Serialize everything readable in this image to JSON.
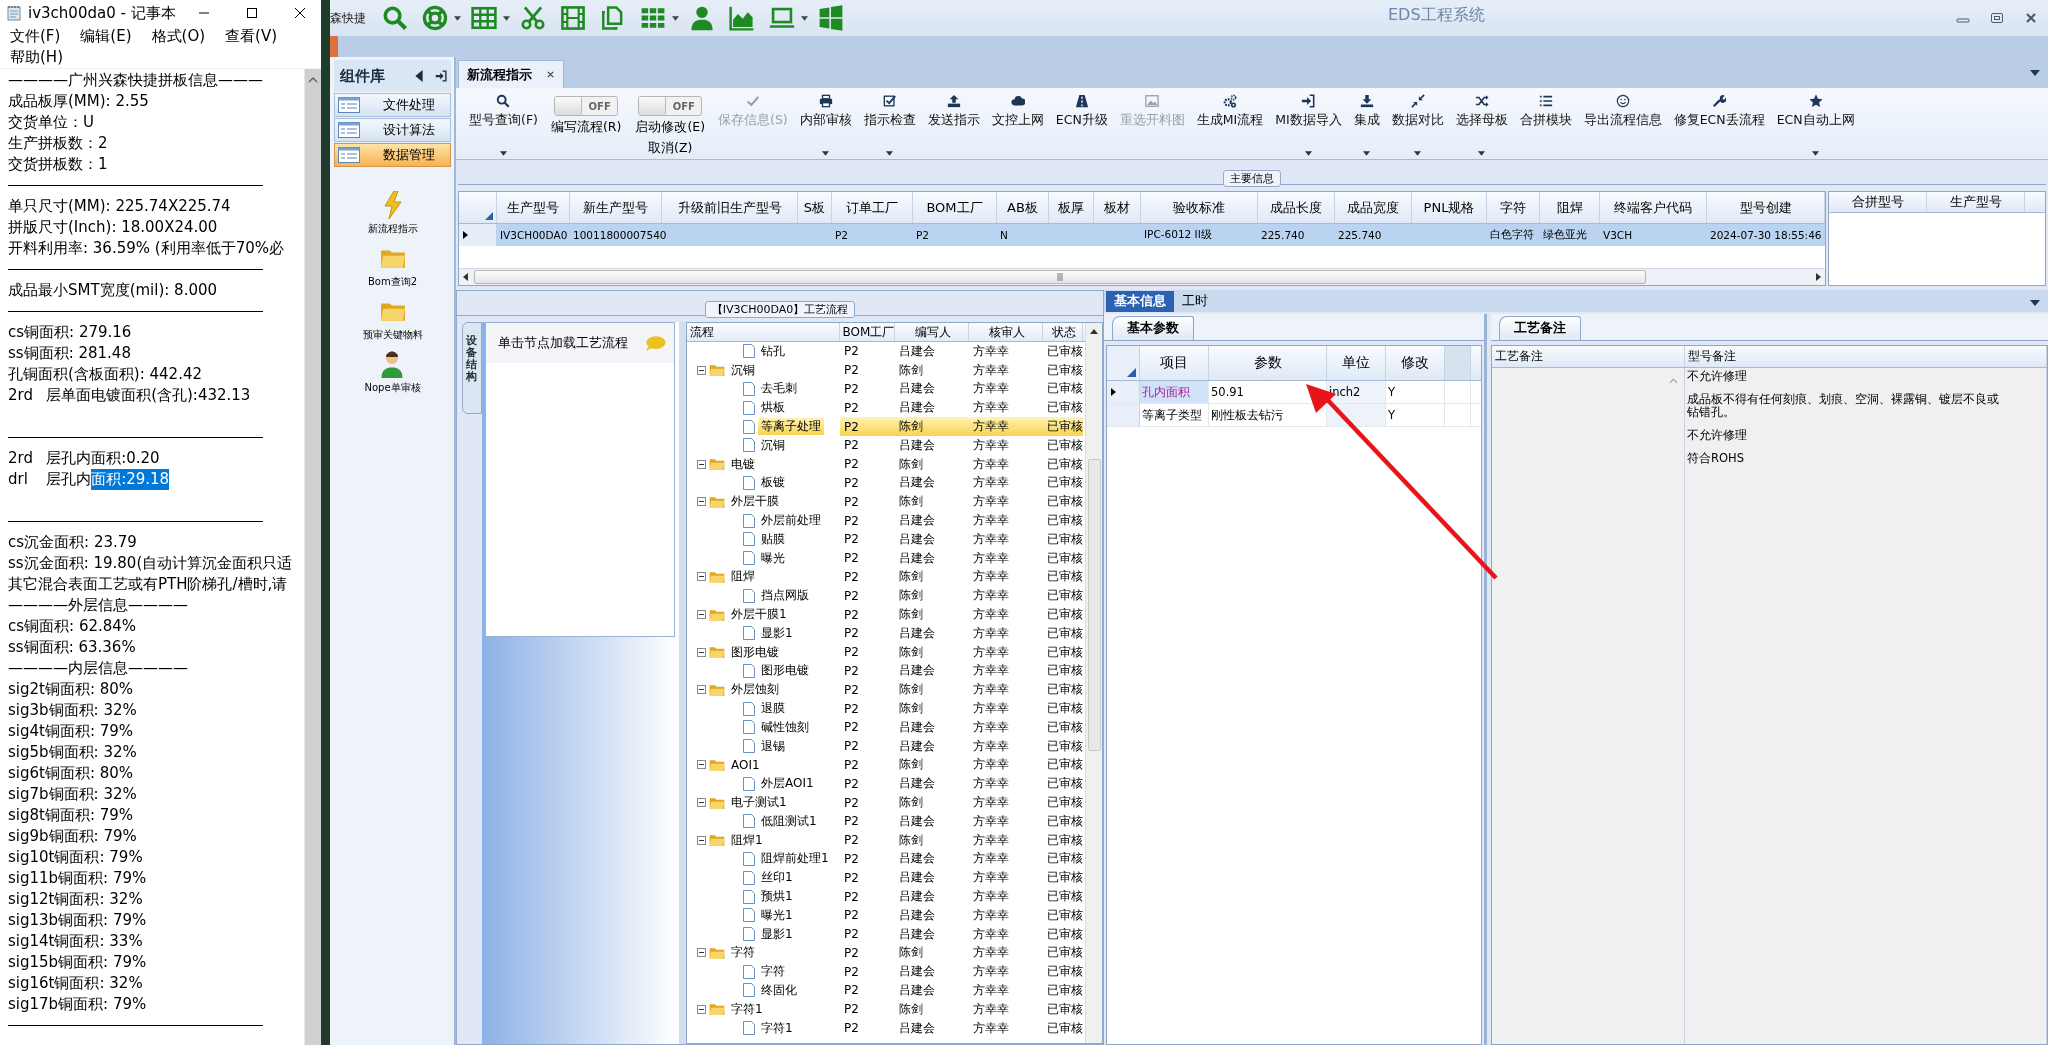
{
  "notepad": {
    "title": "iv3ch00da0 - 记事本",
    "menu": [
      "文件(F)",
      "编辑(E)",
      "格式(O)",
      "查看(V)",
      "帮助(H)"
    ],
    "lines": [
      {
        "kind": "text",
        "text": "————广州兴森快捷拼板信息———"
      },
      {
        "kind": "text",
        "text": "成品板厚(MM): 2.55"
      },
      {
        "kind": "text",
        "text": "交货单位：U"
      },
      {
        "kind": "text",
        "text": "生产拼板数：2"
      },
      {
        "kind": "text",
        "text": "交货拼板数：1"
      },
      {
        "kind": "rule"
      },
      {
        "kind": "text",
        "text": "单只尺寸(MM): 225.74X225.74"
      },
      {
        "kind": "text",
        "text": "拼版尺寸(Inch): 18.00X24.00"
      },
      {
        "kind": "text",
        "text": "开料利用率: 36.59% (利用率低于70%必"
      },
      {
        "kind": "rule"
      },
      {
        "kind": "text",
        "text": "成品最小SMT宽度(mil): 8.000"
      },
      {
        "kind": "rule"
      },
      {
        "kind": "text",
        "text": "cs铜面积: 279.16"
      },
      {
        "kind": "text",
        "text": "ss铜面积: 281.48"
      },
      {
        "kind": "text",
        "text": "孔铜面积(含板面积): 442.42"
      },
      {
        "kind": "text",
        "text": "2rd\t层单面电镀面积(含孔):432.13"
      },
      {
        "kind": "blank"
      },
      {
        "kind": "rule"
      },
      {
        "kind": "text",
        "text": "2rd\t层孔内面积:0.20"
      },
      {
        "kind": "selection",
        "text": "drl\t层孔内",
        "selected": "面积:29.18"
      },
      {
        "kind": "blank"
      },
      {
        "kind": "rule"
      },
      {
        "kind": "text",
        "text": "cs沉金面积: 23.79"
      },
      {
        "kind": "text",
        "text": "ss沉金面积: 19.80(自动计算沉金面积只适"
      },
      {
        "kind": "text",
        "text": "其它混合表面工艺或有PTH阶梯孔/槽时,请"
      },
      {
        "kind": "text",
        "text": "————外层信息————"
      },
      {
        "kind": "text",
        "text": "cs铜面积: 62.84%"
      },
      {
        "kind": "text",
        "text": "ss铜面积: 63.36%"
      },
      {
        "kind": "text",
        "text": "————内层信息————"
      },
      {
        "kind": "text",
        "text": "sig2t铜面积: 80%"
      },
      {
        "kind": "text",
        "text": "sig3b铜面积: 32%"
      },
      {
        "kind": "text",
        "text": "sig4t铜面积: 79%"
      },
      {
        "kind": "text",
        "text": "sig5b铜面积: 32%"
      },
      {
        "kind": "text",
        "text": "sig6t铜面积: 80%"
      },
      {
        "kind": "text",
        "text": "sig7b铜面积: 32%"
      },
      {
        "kind": "text",
        "text": "sig8t铜面积: 79%"
      },
      {
        "kind": "text",
        "text": "sig9b铜面积: 79%"
      },
      {
        "kind": "text",
        "text": "sig10t铜面积: 79%"
      },
      {
        "kind": "text",
        "text": "sig11b铜面积: 79%"
      },
      {
        "kind": "text",
        "text": "sig12t铜面积: 32%"
      },
      {
        "kind": "text",
        "text": "sig13b铜面积: 79%"
      },
      {
        "kind": "text",
        "text": "sig14t铜面积: 33%"
      },
      {
        "kind": "text",
        "text": "sig15b铜面积: 79%"
      },
      {
        "kind": "text",
        "text": "sig16t铜面积: 32%"
      },
      {
        "kind": "text",
        "text": "sig17b铜面积: 79%"
      },
      {
        "kind": "rule"
      }
    ]
  },
  "app": {
    "title": "EDS工程系统",
    "brand_fragment": "森快捷"
  },
  "sidebar": {
    "title": "组件库",
    "sections": [
      {
        "label": "文件处理",
        "selected": false
      },
      {
        "label": "设计算法",
        "selected": false
      },
      {
        "label": "数据管理",
        "selected": true
      }
    ],
    "items": [
      {
        "label": "新流程指示",
        "kind": "lightning"
      },
      {
        "label": "Bom查询2",
        "kind": "folder"
      },
      {
        "label": "预审关键物料",
        "kind": "folder"
      },
      {
        "label": "Nope单审核",
        "kind": "person"
      }
    ]
  },
  "tabs": [
    {
      "label": "新流程指示",
      "selected": true
    }
  ],
  "toolbar": [
    {
      "kind": "button",
      "label": "型号查询(F)",
      "dropdown": true,
      "disabled": false
    },
    {
      "kind": "toggle",
      "label": "编写流程(R)",
      "switch_text": "OFF",
      "on": false
    },
    {
      "kind": "toggle",
      "label": "启动修改(E)",
      "sublabel": "取消(Z)",
      "switch_text": "OFF",
      "on": false
    },
    {
      "kind": "button",
      "label": "保存信息(S)",
      "dropdown": false,
      "disabled": true
    },
    {
      "kind": "button",
      "label": "内部审核",
      "dropdown": true,
      "disabled": false
    },
    {
      "kind": "button",
      "label": "指示检查",
      "dropdown": true,
      "disabled": false
    },
    {
      "kind": "button",
      "label": "发送指示",
      "dropdown": false,
      "disabled": false
    },
    {
      "kind": "button",
      "label": "文控上网",
      "dropdown": false,
      "disabled": false
    },
    {
      "kind": "button",
      "label": "ECN升级",
      "dropdown": false,
      "disabled": false
    },
    {
      "kind": "button",
      "label": "重选开料图",
      "dropdown": false,
      "disabled": true
    },
    {
      "kind": "button",
      "label": "生成MI流程",
      "dropdown": false,
      "disabled": false
    },
    {
      "kind": "button",
      "label": "MI数据导入",
      "dropdown": true,
      "disabled": false
    },
    {
      "kind": "button",
      "label": "集成",
      "dropdown": true,
      "disabled": false
    },
    {
      "kind": "button",
      "label": "数据对比",
      "dropdown": true,
      "disabled": false
    },
    {
      "kind": "button",
      "label": "选择母板",
      "dropdown": true,
      "disabled": false
    },
    {
      "kind": "button",
      "label": "合拼模块",
      "dropdown": false,
      "disabled": false
    },
    {
      "kind": "button",
      "label": "导出流程信息",
      "dropdown": false,
      "disabled": false
    },
    {
      "kind": "button",
      "label": "修复ECN丢流程",
      "dropdown": false,
      "disabled": false
    },
    {
      "kind": "button",
      "label": "ECN自动上网",
      "dropdown": true,
      "disabled": false
    }
  ],
  "main_info": {
    "legend": "主要信息",
    "columns": [
      "生产型号",
      "新生产型号",
      "升级前旧生产型号",
      "S板",
      "订单工厂",
      "BOM工厂",
      "AB板",
      "板厚",
      "板材",
      "验收标准",
      "成品长度",
      "成品宽度",
      "PNL规格",
      "字符",
      "阻焊",
      "终端客户代码",
      "型号创建"
    ],
    "rows": [
      {
        "selected": true,
        "cells": [
          "IV3CH00DA0",
          "10011800007540",
          null,
          null,
          "P2",
          "P2",
          "N",
          null,
          null,
          "IPC-6012 II级",
          "225.740",
          "225.740",
          null,
          "白色字符",
          "绿色亚光",
          "V3CH",
          "2024-07-30 18:55:46"
        ]
      }
    ],
    "merge_columns": [
      "合拼型号",
      "生产型号"
    ]
  },
  "process": {
    "legend": "【IV3CH00DA0】工艺流程",
    "side_tab": "设备结构",
    "hint": "单击节点加载工艺流程",
    "columns": [
      "流程",
      "BOM工厂",
      "编写人",
      "核审人",
      "状态"
    ],
    "tree": [
      {
        "children": [
          {
            "name": "钻孔",
            "bom": "P2",
            "writer": "吕建会",
            "reviewer": "方幸幸",
            "status": "已审核",
            "selected": false
          }
        ]
      },
      {
        "name": "沉铜",
        "bom": "P2",
        "writer": "陈剑",
        "reviewer": "方幸幸",
        "status": "已审核",
        "selected": false,
        "expanded": true,
        "children": [
          {
            "name": "去毛刺",
            "bom": "P2",
            "writer": "吕建会",
            "reviewer": "方幸幸",
            "status": "已审核",
            "selected": false
          },
          {
            "name": "烘板",
            "bom": "P2",
            "writer": "吕建会",
            "reviewer": "方幸幸",
            "status": "已审核",
            "selected": false
          },
          {
            "name": "等离子处理",
            "bom": "P2",
            "writer": "陈剑",
            "reviewer": "方幸幸",
            "status": "已审核",
            "selected": true
          },
          {
            "name": "沉铜",
            "bom": "P2",
            "writer": "吕建会",
            "reviewer": "方幸幸",
            "status": "已审核",
            "selected": false
          }
        ]
      },
      {
        "name": "电镀",
        "bom": "P2",
        "writer": "陈剑",
        "reviewer": "方幸幸",
        "status": "已审核",
        "selected": false,
        "expanded": true,
        "children": [
          {
            "name": "板镀",
            "bom": "P2",
            "writer": "吕建会",
            "reviewer": "方幸幸",
            "status": "已审核",
            "selected": false
          }
        ]
      },
      {
        "name": "外层干膜",
        "bom": "P2",
        "writer": "陈剑",
        "reviewer": "方幸幸",
        "status": "已审核",
        "selected": false,
        "expanded": true,
        "children": [
          {
            "name": "外层前处理",
            "bom": "P2",
            "writer": "吕建会",
            "reviewer": "方幸幸",
            "status": "已审核",
            "selected": false
          },
          {
            "name": "贴膜",
            "bom": "P2",
            "writer": "吕建会",
            "reviewer": "方幸幸",
            "status": "已审核",
            "selected": false
          },
          {
            "name": "曝光",
            "bom": "P2",
            "writer": "吕建会",
            "reviewer": "方幸幸",
            "status": "已审核",
            "selected": false
          }
        ]
      },
      {
        "name": "阻焊",
        "bom": "P2",
        "writer": "陈剑",
        "reviewer": "方幸幸",
        "status": "已审核",
        "selected": false,
        "expanded": true,
        "children": [
          {
            "name": "挡点网版",
            "bom": "P2",
            "writer": "陈剑",
            "reviewer": "方幸幸",
            "status": "已审核",
            "selected": false
          }
        ]
      },
      {
        "name": "外层干膜1",
        "bom": "P2",
        "writer": "陈剑",
        "reviewer": "方幸幸",
        "status": "已审核",
        "selected": false,
        "expanded": true,
        "children": [
          {
            "name": "显影1",
            "bom": "P2",
            "writer": "吕建会",
            "reviewer": "方幸幸",
            "status": "已审核",
            "selected": false
          }
        ]
      },
      {
        "name": "图形电镀",
        "bom": "P2",
        "writer": "陈剑",
        "reviewer": "方幸幸",
        "status": "已审核",
        "selected": false,
        "expanded": true,
        "children": [
          {
            "name": "图形电镀",
            "bom": "P2",
            "writer": "吕建会",
            "reviewer": "方幸幸",
            "status": "已审核",
            "selected": false
          }
        ]
      },
      {
        "name": "外层蚀刻",
        "bom": "P2",
        "writer": "陈剑",
        "reviewer": "方幸幸",
        "status": "已审核",
        "selected": false,
        "expanded": true,
        "children": [
          {
            "name": "退膜",
            "bom": "P2",
            "writer": "陈剑",
            "reviewer": "方幸幸",
            "status": "已审核",
            "selected": false
          },
          {
            "name": "碱性蚀刻",
            "bom": "P2",
            "writer": "吕建会",
            "reviewer": "方幸幸",
            "status": "已审核",
            "selected": false
          },
          {
            "name": "退锡",
            "bom": "P2",
            "writer": "吕建会",
            "reviewer": "方幸幸",
            "status": "已审核",
            "selected": false
          }
        ]
      },
      {
        "name": "AOI1",
        "bom": "P2",
        "writer": "陈剑",
        "reviewer": "方幸幸",
        "status": "已审核",
        "selected": false,
        "expanded": true,
        "children": [
          {
            "name": "外层AOI1",
            "bom": "P2",
            "writer": "吕建会",
            "reviewer": "方幸幸",
            "status": "已审核",
            "selected": false
          }
        ]
      },
      {
        "name": "电子测试1",
        "bom": "P2",
        "writer": "陈剑",
        "reviewer": "方幸幸",
        "status": "已审核",
        "selected": false,
        "expanded": true,
        "children": [
          {
            "name": "低阻测试1",
            "bom": "P2",
            "writer": "吕建会",
            "reviewer": "方幸幸",
            "status": "已审核",
            "selected": false
          }
        ]
      },
      {
        "name": "阻焊1",
        "bom": "P2",
        "writer": "陈剑",
        "reviewer": "方幸幸",
        "status": "已审核",
        "selected": false,
        "expanded": true,
        "children": [
          {
            "name": "阻焊前处理1",
            "bom": "P2",
            "writer": "吕建会",
            "reviewer": "方幸幸",
            "status": "已审核",
            "selected": false
          },
          {
            "name": "丝印1",
            "bom": "P2",
            "writer": "吕建会",
            "reviewer": "方幸幸",
            "status": "已审核",
            "selected": false
          },
          {
            "name": "预烘1",
            "bom": "P2",
            "writer": "吕建会",
            "reviewer": "方幸幸",
            "status": "已审核",
            "selected": false
          },
          {
            "name": "曝光1",
            "bom": "P2",
            "writer": "吕建会",
            "reviewer": "方幸幸",
            "status": "已审核",
            "selected": false
          },
          {
            "name": "显影1",
            "bom": "P2",
            "writer": "吕建会",
            "reviewer": "方幸幸",
            "status": "已审核",
            "selected": false
          }
        ]
      },
      {
        "name": "字符",
        "bom": "P2",
        "writer": "陈剑",
        "reviewer": "方幸幸",
        "status": "已审核",
        "selected": false,
        "expanded": true,
        "children": [
          {
            "name": "字符",
            "bom": "P2",
            "writer": "吕建会",
            "reviewer": "方幸幸",
            "status": "已审核",
            "selected": false
          },
          {
            "name": "终固化",
            "bom": "P2",
            "writer": "吕建会",
            "reviewer": "方幸幸",
            "status": "已审核",
            "selected": false
          }
        ]
      },
      {
        "name": "字符1",
        "bom": "P2",
        "writer": "陈剑",
        "reviewer": "方幸幸",
        "status": "已审核",
        "selected": false,
        "expanded": true,
        "children": [
          {
            "name": "字符1",
            "bom": "P2",
            "writer": "吕建会",
            "reviewer": "方幸幸",
            "status": "已审核",
            "selected": false
          }
        ]
      }
    ]
  },
  "details": {
    "tabs": [
      {
        "label": "基本信息",
        "selected": true
      },
      {
        "label": "工时",
        "selected": false
      }
    ],
    "params": {
      "tab": "基本参数",
      "columns": [
        "项目",
        "参数",
        "单位",
        "修改"
      ],
      "rows": [
        {
          "selected": true,
          "cells": [
            "孔内面积",
            "50.91",
            "inch2",
            "Y"
          ]
        },
        {
          "selected": false,
          "cells": [
            "等离子类型",
            "刚性板去钻污",
            null,
            "Y"
          ]
        }
      ]
    },
    "notes": {
      "tab": "工艺备注",
      "columns": [
        "工艺备注",
        "型号备注"
      ],
      "model_notes": [
        "不允许修理",
        "成品板不得有任何刻痕、划痕、空洞、裸露铜、镀层不良或钻错孔。",
        "不允许修理",
        "符合ROHS"
      ]
    }
  }
}
